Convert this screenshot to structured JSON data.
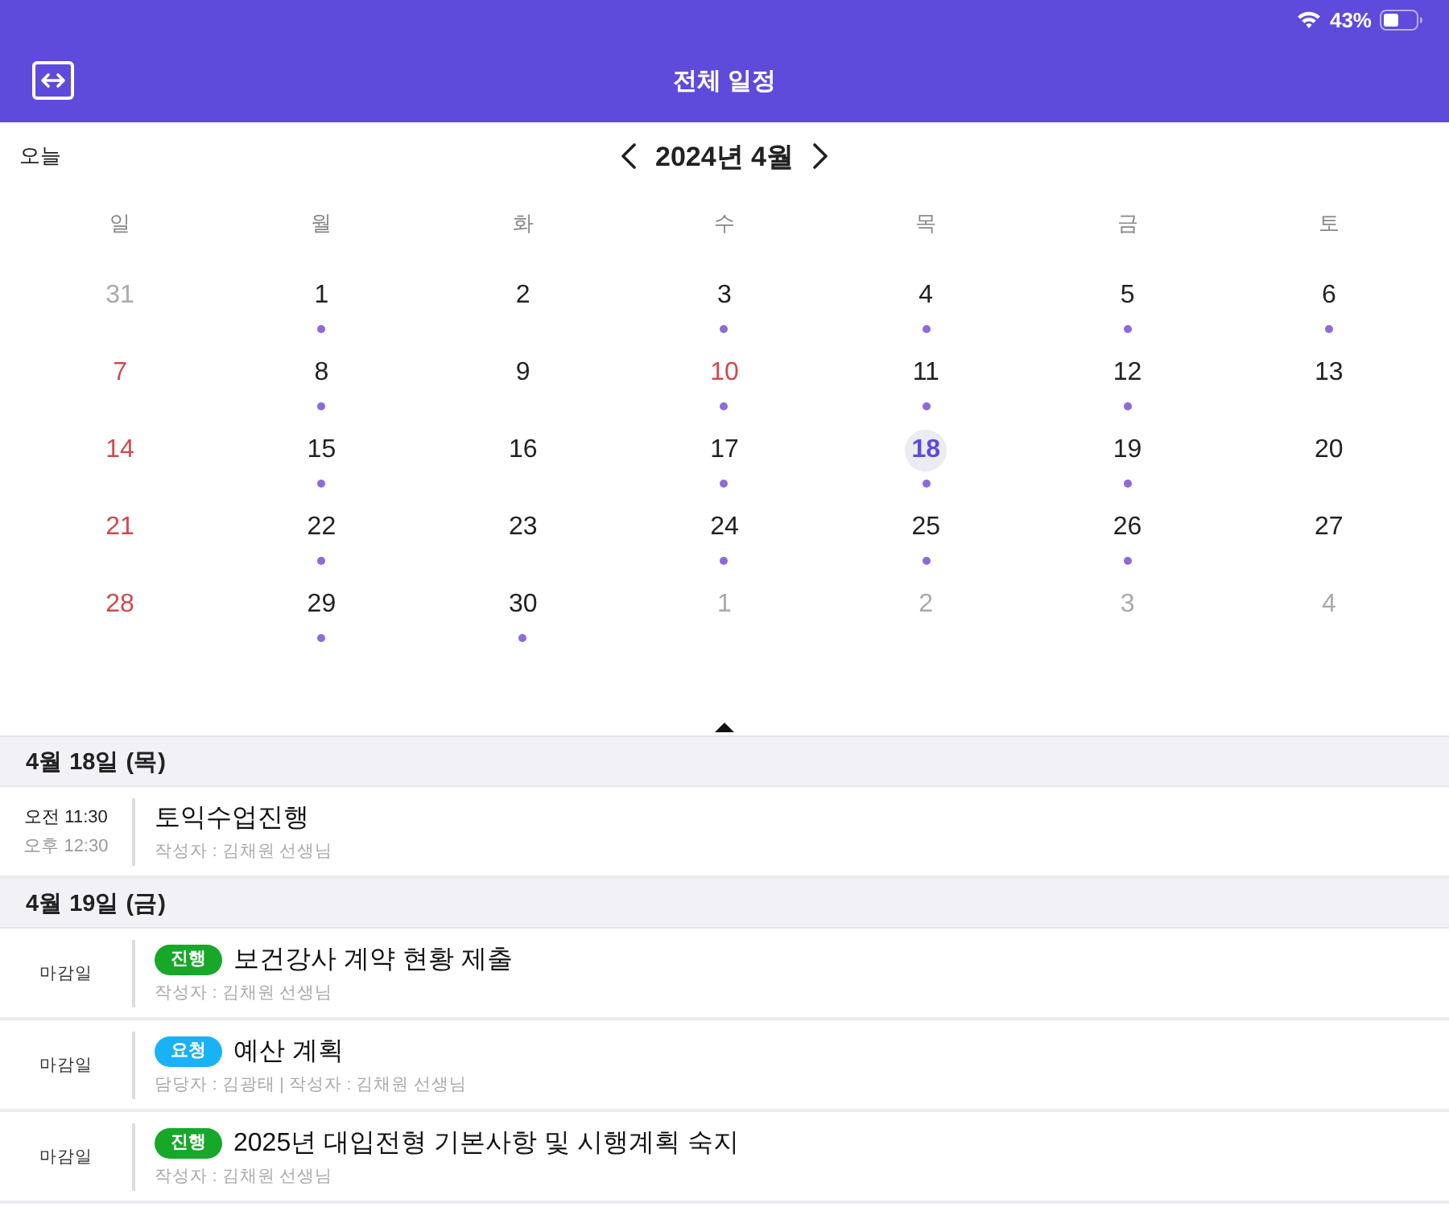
{
  "status_bar": {
    "battery": "43%"
  },
  "header": {
    "title": "전체 일정"
  },
  "nav": {
    "today": "오늘",
    "month": "2024년 4월"
  },
  "calendar": {
    "weekdays": [
      "일",
      "월",
      "화",
      "수",
      "목",
      "금",
      "토"
    ],
    "weeks": [
      [
        {
          "day": "31",
          "outside": true,
          "holiday": false,
          "has_events": false,
          "selected": false
        },
        {
          "day": "1",
          "outside": false,
          "holiday": false,
          "has_events": true,
          "selected": false
        },
        {
          "day": "2",
          "outside": false,
          "holiday": false,
          "has_events": false,
          "selected": false
        },
        {
          "day": "3",
          "outside": false,
          "holiday": false,
          "has_events": true,
          "selected": false
        },
        {
          "day": "4",
          "outside": false,
          "holiday": false,
          "has_events": true,
          "selected": false
        },
        {
          "day": "5",
          "outside": false,
          "holiday": false,
          "has_events": true,
          "selected": false
        },
        {
          "day": "6",
          "outside": false,
          "holiday": false,
          "has_events": true,
          "selected": false
        }
      ],
      [
        {
          "day": "7",
          "outside": false,
          "holiday": true,
          "has_events": false,
          "selected": false
        },
        {
          "day": "8",
          "outside": false,
          "holiday": false,
          "has_events": true,
          "selected": false
        },
        {
          "day": "9",
          "outside": false,
          "holiday": false,
          "has_events": false,
          "selected": false
        },
        {
          "day": "10",
          "outside": false,
          "holiday": true,
          "has_events": true,
          "selected": false
        },
        {
          "day": "11",
          "outside": false,
          "holiday": false,
          "has_events": true,
          "selected": false
        },
        {
          "day": "12",
          "outside": false,
          "holiday": false,
          "has_events": true,
          "selected": false
        },
        {
          "day": "13",
          "outside": false,
          "holiday": false,
          "has_events": false,
          "selected": false
        }
      ],
      [
        {
          "day": "14",
          "outside": false,
          "holiday": true,
          "has_events": false,
          "selected": false
        },
        {
          "day": "15",
          "outside": false,
          "holiday": false,
          "has_events": true,
          "selected": false
        },
        {
          "day": "16",
          "outside": false,
          "holiday": false,
          "has_events": false,
          "selected": false
        },
        {
          "day": "17",
          "outside": false,
          "holiday": false,
          "has_events": true,
          "selected": false
        },
        {
          "day": "18",
          "outside": false,
          "holiday": false,
          "has_events": true,
          "selected": true
        },
        {
          "day": "19",
          "outside": false,
          "holiday": false,
          "has_events": true,
          "selected": false
        },
        {
          "day": "20",
          "outside": false,
          "holiday": false,
          "has_events": false,
          "selected": false
        }
      ],
      [
        {
          "day": "21",
          "outside": false,
          "holiday": true,
          "has_events": false,
          "selected": false
        },
        {
          "day": "22",
          "outside": false,
          "holiday": false,
          "has_events": true,
          "selected": false
        },
        {
          "day": "23",
          "outside": false,
          "holiday": false,
          "has_events": false,
          "selected": false
        },
        {
          "day": "24",
          "outside": false,
          "holiday": false,
          "has_events": true,
          "selected": false
        },
        {
          "day": "25",
          "outside": false,
          "holiday": false,
          "has_events": true,
          "selected": false
        },
        {
          "day": "26",
          "outside": false,
          "holiday": false,
          "has_events": true,
          "selected": false
        },
        {
          "day": "27",
          "outside": false,
          "holiday": false,
          "has_events": false,
          "selected": false
        }
      ],
      [
        {
          "day": "28",
          "outside": false,
          "holiday": true,
          "has_events": false,
          "selected": false
        },
        {
          "day": "29",
          "outside": false,
          "holiday": false,
          "has_events": true,
          "selected": false
        },
        {
          "day": "30",
          "outside": false,
          "holiday": false,
          "has_events": true,
          "selected": false
        },
        {
          "day": "1",
          "outside": true,
          "holiday": false,
          "has_events": false,
          "selected": false
        },
        {
          "day": "2",
          "outside": true,
          "holiday": false,
          "has_events": false,
          "selected": false
        },
        {
          "day": "3",
          "outside": true,
          "holiday": false,
          "has_events": false,
          "selected": false
        },
        {
          "day": "4",
          "outside": true,
          "holiday": false,
          "has_events": false,
          "selected": false
        }
      ]
    ]
  },
  "agenda": [
    {
      "date": "4월 18일 (목)",
      "events": [
        {
          "kind": "timed",
          "start": "오전 11:30",
          "end": "오후 12:30",
          "title": "토익수업진행",
          "meta": "작성자 : 김채원 선생님"
        }
      ]
    },
    {
      "date": "4월 19일 (금)",
      "events": [
        {
          "kind": "deadline",
          "label": "마감일",
          "status": {
            "text": "진행",
            "color": "#17a82a"
          },
          "title": "보건강사 계약 현황 제출",
          "meta": "작성자 : 김채원 선생님"
        },
        {
          "kind": "deadline",
          "label": "마감일",
          "status": {
            "text": "요청",
            "color": "#1ab2f5"
          },
          "title": "예산 계획",
          "meta": "담당자 : 김광태 | 작성자 : 김채원 선생님"
        },
        {
          "kind": "deadline",
          "label": "마감일",
          "status": {
            "text": "진행",
            "color": "#17a82a"
          },
          "title": "2025년 대입전형 기본사항 및 시행계획 숙지",
          "meta": "작성자 : 김채원 선생님"
        }
      ]
    }
  ]
}
